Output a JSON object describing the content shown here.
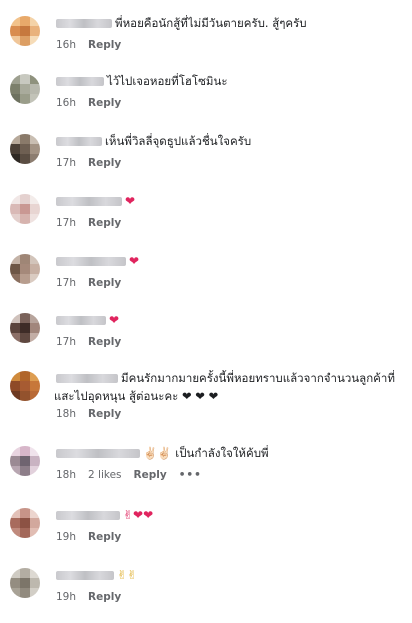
{
  "comments": [
    {
      "text": "พี่หอยคือนักสู้ที่ไม่มีวันตายครับ. สู้ๆครับ",
      "emoji": "",
      "time": "16h",
      "likes": "",
      "reply": "Reply",
      "more": ""
    },
    {
      "text": "ไว้ไปเจอหอยที่โฮโซมินะ",
      "emoji": "",
      "time": "16h",
      "likes": "",
      "reply": "Reply",
      "more": ""
    },
    {
      "text": "เห็นพี่วิลลี่จุดธูปแล้วชื่นใจครับ",
      "emoji": "",
      "time": "17h",
      "likes": "",
      "reply": "Reply",
      "more": ""
    },
    {
      "text": "",
      "emoji": "❤",
      "time": "17h",
      "likes": "",
      "reply": "Reply",
      "more": ""
    },
    {
      "text": "",
      "emoji": "❤",
      "time": "17h",
      "likes": "",
      "reply": "Reply",
      "more": ""
    },
    {
      "text": "",
      "emoji": "❤",
      "time": "17h",
      "likes": "",
      "reply": "Reply",
      "more": ""
    },
    {
      "text": "มีคนรักมากมายครั้งนี้พี่หอยทราบแล้วจากจำนวนลูกค้าที่",
      "text2": "แสะไปอุดหนุน สู้ต่อนะคะ ❤ ❤ ❤",
      "emoji": "",
      "time": "18h",
      "likes": "",
      "reply": "Reply",
      "more": ""
    },
    {
      "text": "✌🏻✌🏻 เป็นกำลังใจให้ค้บพี่",
      "emoji": "",
      "time": "18h",
      "likes": "2 likes",
      "reply": "Reply",
      "more": "•••"
    },
    {
      "text": "",
      "emoji": "✌❤❤",
      "time": "19h",
      "likes": "",
      "reply": "Reply",
      "more": ""
    },
    {
      "text": "",
      "emoji": "✌✌",
      "time": "19h",
      "likes": "",
      "reply": "Reply",
      "more": ""
    }
  ]
}
